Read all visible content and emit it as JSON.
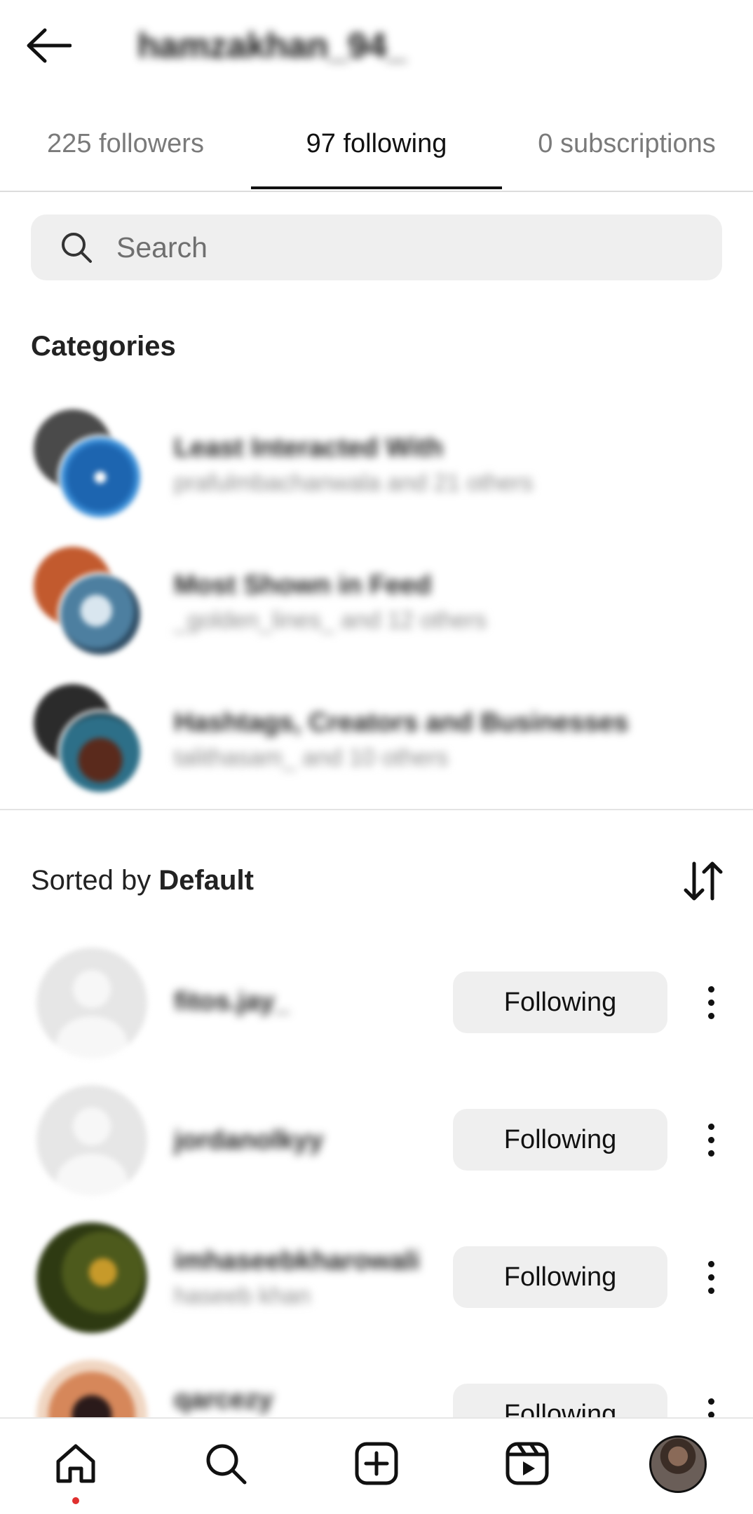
{
  "header": {
    "username": "hamzakhan_94_"
  },
  "tabs": [
    {
      "label": "225 followers",
      "active": false
    },
    {
      "label": "97 following",
      "active": true
    },
    {
      "label": "0 subscriptions",
      "active": false
    }
  ],
  "search": {
    "placeholder": "Search"
  },
  "categories": {
    "title": "Categories",
    "items": [
      {
        "title": "Least Interacted With",
        "subtitle": "prafulmbachanwala and 21 others"
      },
      {
        "title": "Most Shown in Feed",
        "subtitle": "_golden_lines_ and 12 others"
      },
      {
        "title": "Hashtags, Creators and Businesses",
        "subtitle": "talithasam_ and 10 others"
      }
    ]
  },
  "sort": {
    "prefix": "Sorted by ",
    "value": "Default"
  },
  "following": [
    {
      "name": "fitos.jay_",
      "subtitle": "",
      "button": "Following"
    },
    {
      "name": "jordanolkyy",
      "subtitle": "",
      "button": "Following"
    },
    {
      "name": "imhaseebkharowali",
      "subtitle": "haseeb khan",
      "button": "Following"
    },
    {
      "name": "qarcezy",
      "subtitle": "",
      "button": "Following"
    }
  ],
  "colors": {
    "accent_dot": "#e0302f",
    "button_bg": "#efefef",
    "text_primary": "#111111",
    "text_secondary": "#7a7a7a"
  },
  "nav": {
    "items": [
      "home-icon",
      "search-icon",
      "create-icon",
      "reels-icon",
      "profile-avatar"
    ]
  }
}
